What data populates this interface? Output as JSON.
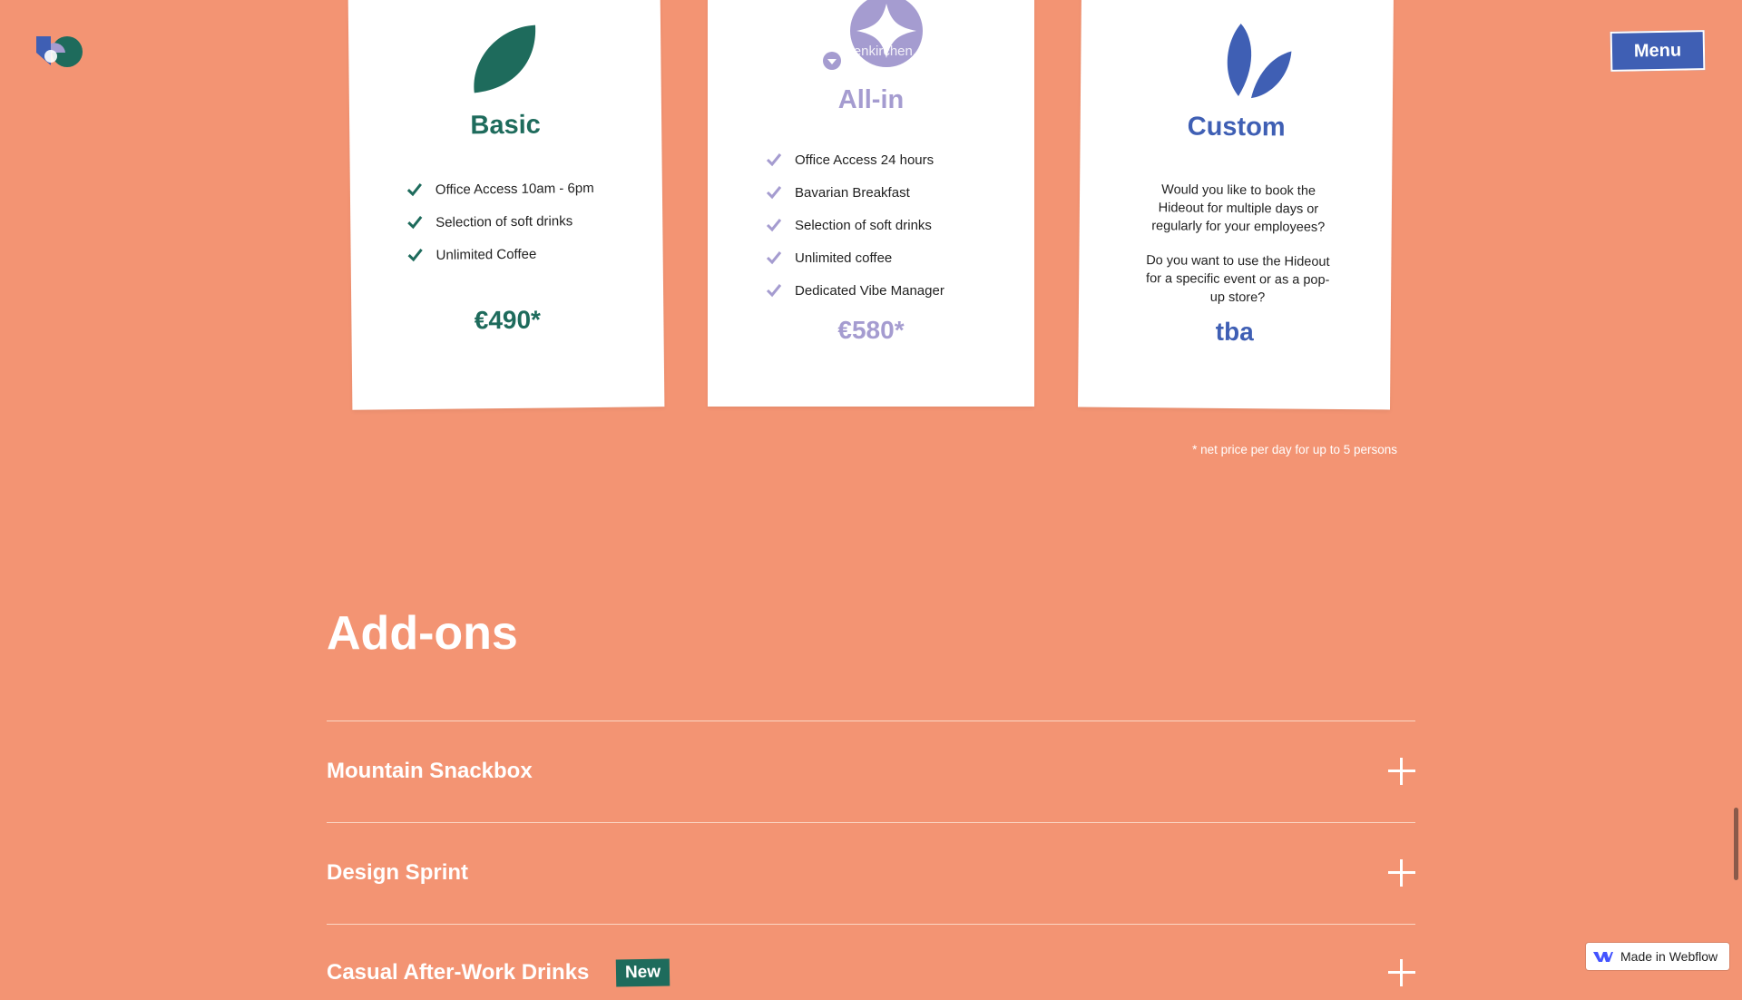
{
  "header": {
    "menu_label": "Menu"
  },
  "plans": [
    {
      "name": "Basic",
      "features": [
        "Office Access 10am - 6pm",
        "Selection of soft drinks",
        "Unlimited Coffee"
      ],
      "price": "€490*",
      "accent": "#1E6B5C"
    },
    {
      "name": "All-in",
      "location": "Garmisch-Partenkirchen, Germany",
      "features": [
        "Office Access 24 hours",
        "Bavarian Breakfast",
        "Selection of soft drinks",
        "Unlimited coffee",
        "Dedicated Vibe Manager"
      ],
      "price": "€580*",
      "accent": "#A59CD0"
    },
    {
      "name": "Custom",
      "text1": "Would you like to book the Hideout for multiple days or regularly for your employees?",
      "text2": "Do you want to use the Hideout for a specific event or as a pop-up store?",
      "price": "tba",
      "accent": "#3F5FB4"
    }
  ],
  "footnote": "* net price per day for up to 5 persons",
  "addons": {
    "title": "Add-ons",
    "items": [
      {
        "label": "Mountain Snackbox"
      },
      {
        "label": "Design Sprint"
      },
      {
        "label": "Casual After-Work Drinks",
        "badge": "New"
      }
    ]
  },
  "webflow_badge": "Made in Webflow",
  "colors": {
    "background": "#F39473",
    "menu": "#3F5FB4"
  }
}
